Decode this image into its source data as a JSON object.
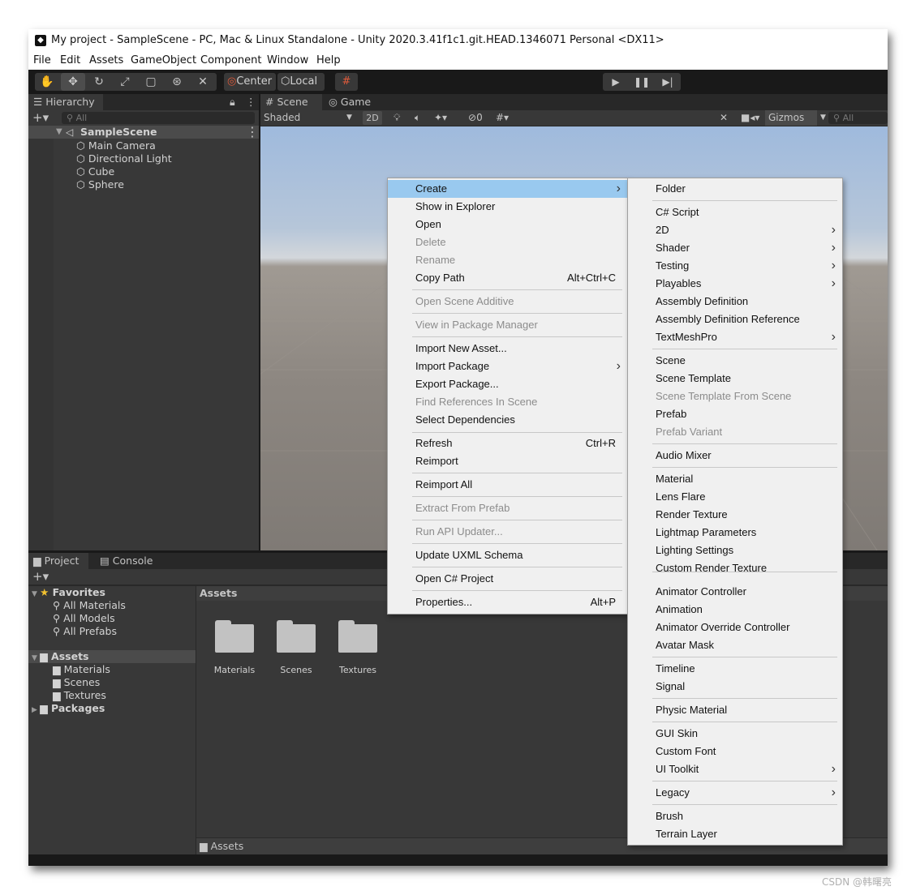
{
  "window": {
    "title": "My project - SampleScene - PC, Mac & Linux Standalone - Unity 2020.3.41f1c1.git.HEAD.1346071 Personal <DX11>"
  },
  "menubar": [
    "File",
    "Edit",
    "Assets",
    "GameObject",
    "Component",
    "Window",
    "Help"
  ],
  "toolbar": {
    "pivot": "Center",
    "space": "Local",
    "tools": [
      "hand-icon",
      "move-icon",
      "rotate-icon",
      "scale-icon",
      "rect-icon",
      "transform-icon",
      "custom-tool-icon"
    ]
  },
  "hierarchy": {
    "tab": "Hierarchy",
    "search_placeholder": "All",
    "scene": "SampleScene",
    "objects": [
      "Main Camera",
      "Directional Light",
      "Cube",
      "Sphere"
    ]
  },
  "scene_view": {
    "tabs": [
      "Scene",
      "Game"
    ],
    "shading": "Shaded",
    "mode_2d": "2D",
    "hidden_count": "0",
    "gizmos": "Gizmos",
    "search_placeholder": "All"
  },
  "project": {
    "tabs": [
      "Project",
      "Console"
    ],
    "favorites_label": "Favorites",
    "favorites": [
      "All Materials",
      "All Models",
      "All Prefabs"
    ],
    "assets_label": "Assets",
    "asset_folders": [
      "Materials",
      "Scenes",
      "Textures"
    ],
    "packages_label": "Packages",
    "breadcrumb": "Assets",
    "grid_folders": [
      "Materials",
      "Scenes",
      "Textures"
    ],
    "path_bar": "Assets"
  },
  "context_menu": {
    "items": [
      {
        "label": "Create",
        "submenu": true,
        "highlighted": true
      },
      {
        "label": "Show in Explorer"
      },
      {
        "label": "Open"
      },
      {
        "label": "Delete",
        "disabled": true
      },
      {
        "label": "Rename",
        "disabled": true
      },
      {
        "label": "Copy Path",
        "shortcut": "Alt+Ctrl+C"
      },
      {
        "label": "Open Scene Additive",
        "disabled": true
      },
      {
        "label": "View in Package Manager",
        "disabled": true
      },
      {
        "label": "Import New Asset..."
      },
      {
        "label": "Import Package",
        "submenu": true
      },
      {
        "label": "Export Package..."
      },
      {
        "label": "Find References In Scene",
        "disabled": true
      },
      {
        "label": "Select Dependencies"
      },
      {
        "label": "Refresh",
        "shortcut": "Ctrl+R"
      },
      {
        "label": "Reimport"
      },
      {
        "label": "Reimport All"
      },
      {
        "label": "Extract From Prefab",
        "disabled": true
      },
      {
        "label": "Run API Updater...",
        "disabled": true
      },
      {
        "label": "Update UXML Schema"
      },
      {
        "label": "Open C# Project"
      },
      {
        "label": "Properties...",
        "shortcut": "Alt+P"
      }
    ]
  },
  "create_submenu": {
    "items": [
      {
        "label": "Folder"
      },
      {
        "label": "C# Script"
      },
      {
        "label": "2D",
        "submenu": true
      },
      {
        "label": "Shader",
        "submenu": true
      },
      {
        "label": "Testing",
        "submenu": true
      },
      {
        "label": "Playables",
        "submenu": true
      },
      {
        "label": "Assembly Definition"
      },
      {
        "label": "Assembly Definition Reference"
      },
      {
        "label": "TextMeshPro",
        "submenu": true
      },
      {
        "label": "Scene"
      },
      {
        "label": "Scene Template"
      },
      {
        "label": "Scene Template From Scene",
        "disabled": true
      },
      {
        "label": "Prefab"
      },
      {
        "label": "Prefab Variant",
        "disabled": true
      },
      {
        "label": "Audio Mixer"
      },
      {
        "label": "Material"
      },
      {
        "label": "Lens Flare"
      },
      {
        "label": "Render Texture"
      },
      {
        "label": "Lightmap Parameters"
      },
      {
        "label": "Lighting Settings"
      },
      {
        "label": "Custom Render Texture"
      },
      {
        "label": "Animator Controller"
      },
      {
        "label": "Animation"
      },
      {
        "label": "Animator Override Controller"
      },
      {
        "label": "Avatar Mask"
      },
      {
        "label": "Timeline"
      },
      {
        "label": "Signal"
      },
      {
        "label": "Physic Material"
      },
      {
        "label": "GUI Skin"
      },
      {
        "label": "Custom Font"
      },
      {
        "label": "UI Toolkit",
        "submenu": true
      },
      {
        "label": "Legacy",
        "submenu": true
      },
      {
        "label": "Brush"
      },
      {
        "label": "Terrain Layer"
      }
    ]
  },
  "watermark": "CSDN @韩曙亮",
  "colors": {
    "editor_dark": "#383838",
    "menu_bg": "#f0f0f0",
    "menu_highlight": "#99c9ef",
    "disabled_text": "#8c8c8c"
  }
}
